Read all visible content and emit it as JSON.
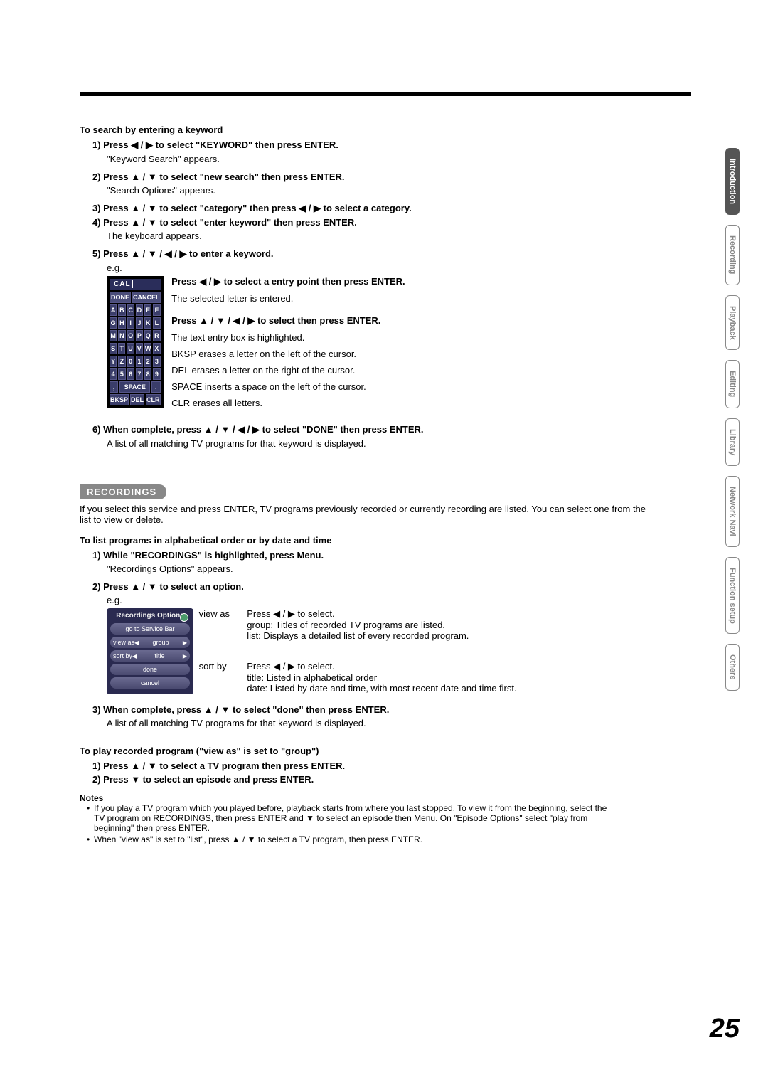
{
  "section_search_h": "To search by entering a keyword",
  "steps1": {
    "s1_b": "1) Press ◀ / ▶ to select \"KEYWORD\" then press ENTER.",
    "s1_sub": "\"Keyword Search\" appears.",
    "s2_b": "2) Press ▲ / ▼ to select \"new search\" then press ENTER.",
    "s2_sub": "\"Search Options\" appears.",
    "s3_b": "3) Press ▲ / ▼ to select \"category\" then press ◀ / ▶ to select a category.",
    "s4_b": "4) Press ▲ / ▼ to select \"enter keyword\" then press ENTER.",
    "s4_sub": "The keyboard appears.",
    "s5_b": "5) Press ▲ / ▼ / ◀ / ▶ to enter a keyword.",
    "eg": "e.g."
  },
  "keyboard": {
    "entry": "CAL",
    "done": "DONE",
    "cancel": "CANCEL",
    "rows": [
      [
        "A",
        "B",
        "C",
        "D",
        "E",
        "F"
      ],
      [
        "G",
        "H",
        "I",
        "J",
        "K",
        "L"
      ],
      [
        "M",
        "N",
        "O",
        "P",
        "Q",
        "R"
      ],
      [
        "S",
        "T",
        "U",
        "V",
        "W",
        "X"
      ],
      [
        "Y",
        "Z",
        "0",
        "1",
        "2",
        "3"
      ],
      [
        "4",
        "5",
        "6",
        "7",
        "8",
        "9"
      ]
    ],
    "bottom1": [
      ",",
      "SPACE",
      "."
    ],
    "bottom2": [
      "BKSP",
      "DEL",
      "CLR"
    ]
  },
  "kb_side": {
    "b1_b": "Press ◀ / ▶ to select a entry point then press ENTER.",
    "b1_t": "The selected letter is entered.",
    "b2_b": "Press ▲ / ▼ / ◀ / ▶ to select then press ENTER.",
    "b2_t": "The text entry box is highlighted.",
    "l1": "BKSP erases a letter on the left of the cursor.",
    "l2": "DEL erases a letter on the right of the cursor.",
    "l3": "SPACE inserts a space on the left of the cursor.",
    "l4": "CLR erases all letters."
  },
  "step6_b": "6) When complete, press ▲ / ▼ / ◀ / ▶  to select \"DONE\" then press ENTER.",
  "step6_sub": "A list of all matching TV programs for that keyword is displayed.",
  "recordings": {
    "header": "RECORDINGS",
    "intro": "If you select this service and press ENTER, TV programs previously recorded or currently recording are listed. You can select one from the list to view or delete.",
    "sub_h": "To list programs in alphabetical order or by date and time",
    "s1_b": "1) While \"RECORDINGS\" is highlighted, press Menu.",
    "s1_sub": "\"Recordings Options\" appears.",
    "s2_b": "2) Press ▲ / ▼ to select an option.",
    "eg": "e.g."
  },
  "ro_box": {
    "title": "Recordings Options",
    "i1": "go to Service Bar",
    "i2_l": "view as",
    "i2_v": "group",
    "i3_l": "sort by",
    "i3_v": "title",
    "i4": "done",
    "i5": "cancel"
  },
  "ro_side": {
    "r1_label": "view as",
    "r1_press": "Press ◀ / ▶ to select.",
    "r1_d1": "group:  Titles of recorded TV programs are listed.",
    "r1_d2": "list:      Displays a detailed list of every recorded program.",
    "r2_label": "sort by",
    "r2_press": "Press ◀ / ▶ to select.",
    "r2_d1": "title:     Listed in alphabetical order",
    "r2_d2": "date:    Listed by date and time, with most recent date and time first."
  },
  "step3_b": "3) When complete, press ▲ / ▼ to select \"done\" then press ENTER.",
  "step3_sub": "A list of all matching TV programs for that keyword is displayed.",
  "play_h": "To play recorded program (\"view as\" is set to \"group\")",
  "play_s1": "1) Press ▲ / ▼ to select a TV program then press ENTER.",
  "play_s2": "2) Press ▼ to select an episode and press ENTER.",
  "notes_h": "Notes",
  "notes": {
    "n1": "If you play a TV program which you played before, playback starts from where you last stopped. To view it from the beginning, select the TV program on RECORDINGS, then press ENTER and ▼ to select an episode then Menu. On \"Episode Options\" select \"play from beginning\" then press ENTER.",
    "n2": "When \"view as\" is set to \"list\", press ▲ / ▼ to select a TV program, then press ENTER."
  },
  "tabs": [
    "Introduction",
    "Recording",
    "Playback",
    "Editing",
    "Library",
    "Network Navi",
    "Function setup",
    "Others"
  ],
  "page": "25"
}
